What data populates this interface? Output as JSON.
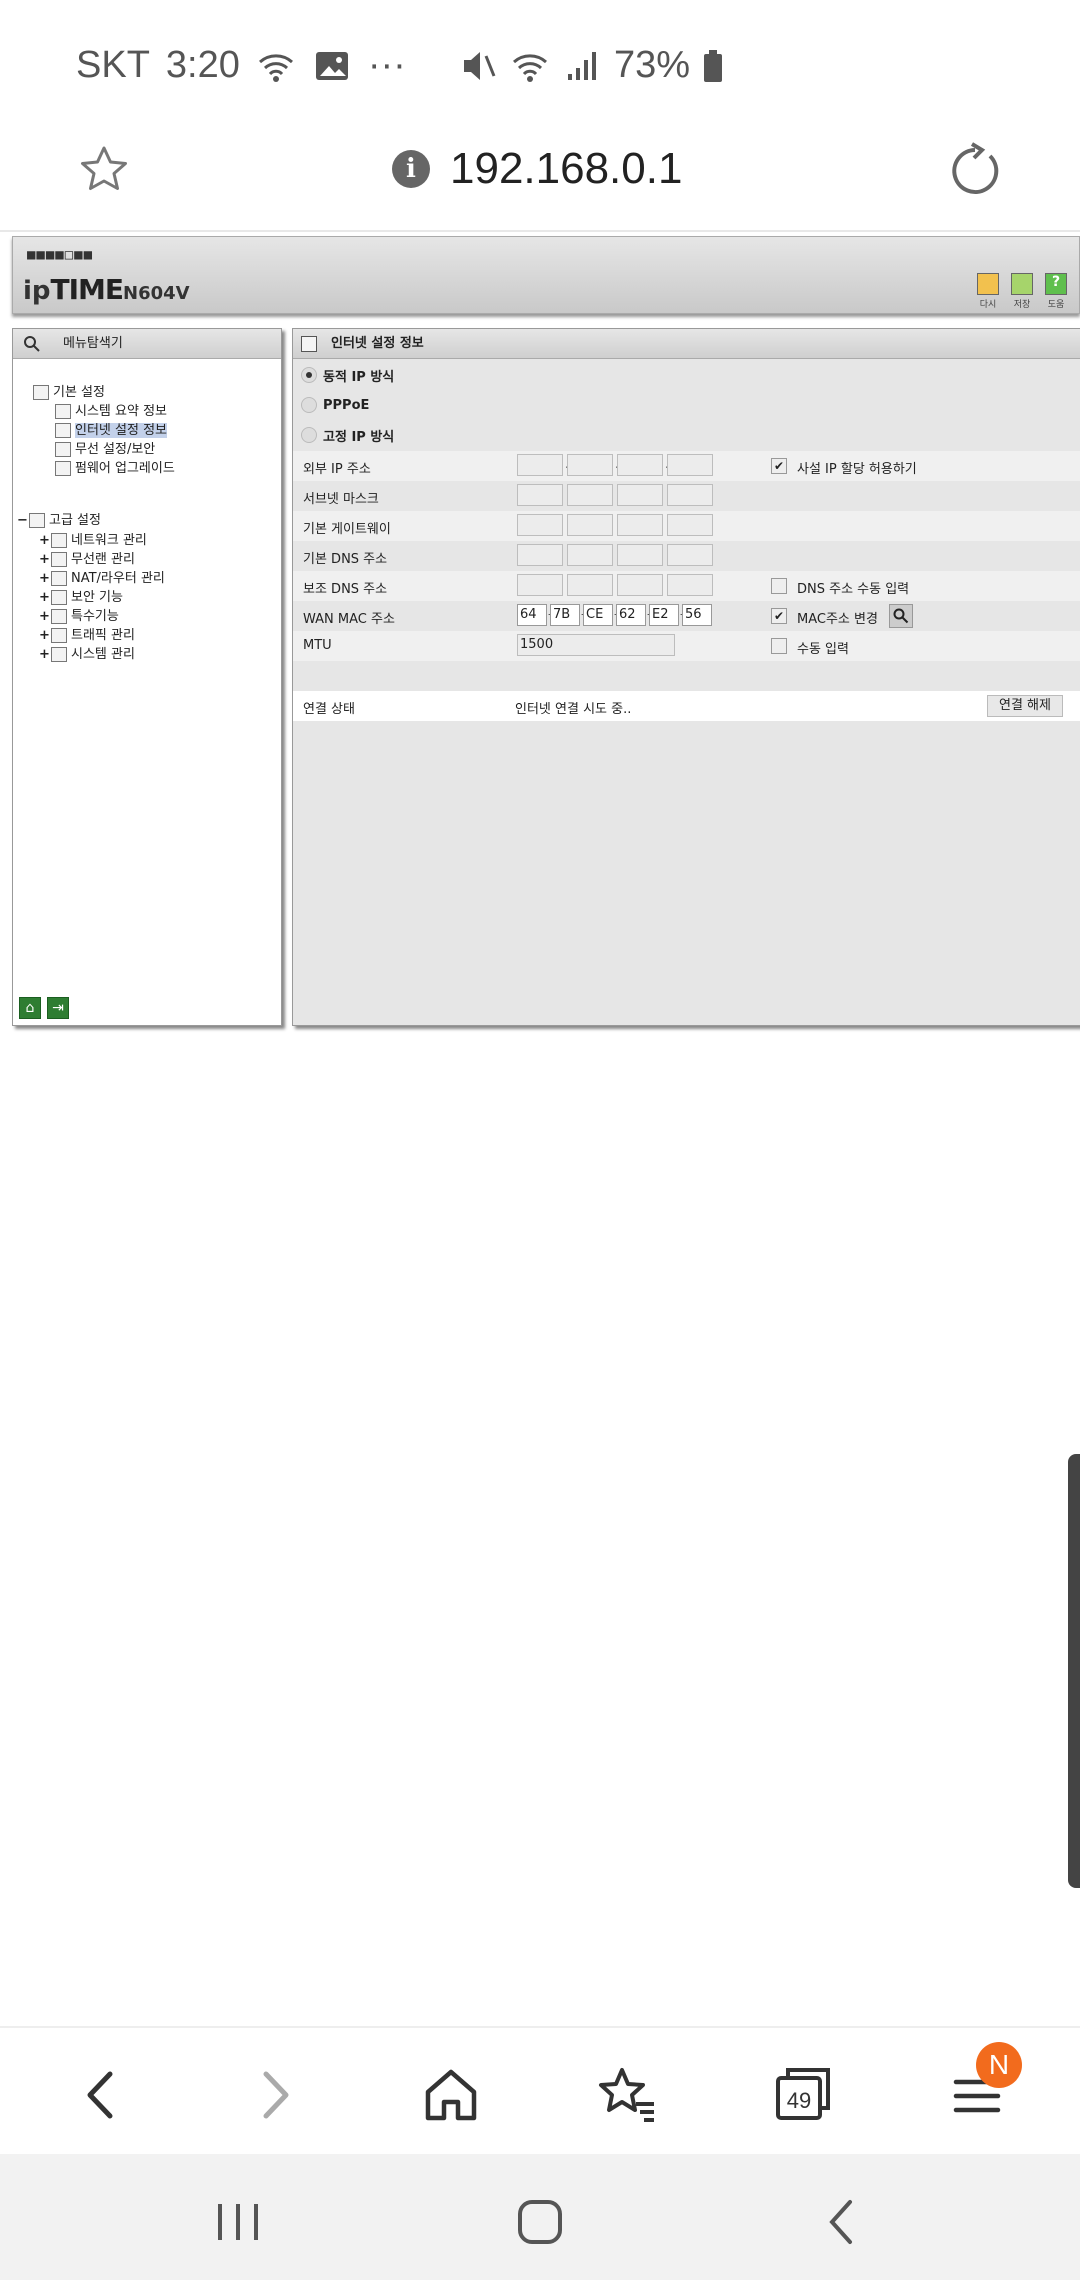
{
  "status_bar": {
    "carrier": "SKT",
    "time": "3:20",
    "more": "···",
    "battery": "73%"
  },
  "browser": {
    "url": "192.168.0.1",
    "tab_count": "49",
    "menu_badge": "N"
  },
  "router": {
    "brand_prefix": "ip",
    "brand_main": "TIME",
    "model": "N604V",
    "toolbar": {
      "reload": "다시",
      "save": "저장",
      "help": "도움"
    },
    "sidebar": {
      "title": "메뉴탐색기",
      "basic": {
        "label": "기본 설정",
        "items": [
          "시스템 요약 정보",
          "인터넷 설정 정보",
          "무선 설정/보안",
          "펌웨어 업그레이드"
        ]
      },
      "advanced": {
        "label": "고급 설정",
        "items": [
          "네트워크 관리",
          "무선랜 관리",
          "NAT/라우터 관리",
          "보안 기능",
          "특수기능",
          "트래픽 관리",
          "시스템 관리"
        ]
      }
    },
    "panel": {
      "title": "인터넷 설정 정보",
      "modes": [
        "동적 IP 방식",
        "PPPoE",
        "고정 IP 방식"
      ],
      "selected_mode": "동적 IP 방식",
      "fields": {
        "external_ip": "외부 IP 주소",
        "subnet": "서브넷 마스크",
        "gateway": "기본 게이트웨이",
        "dns1": "기본 DNS 주소",
        "dns2": "보조 DNS 주소",
        "wan_mac": "WAN MAC 주소",
        "mtu": "MTU"
      },
      "options": {
        "private_ip": {
          "label": "사설 IP 할당 허용하기",
          "checked": true
        },
        "dns_manual": {
          "label": "DNS 주소 수동 입력",
          "checked": false
        },
        "mac_change": {
          "label": "MAC주소 변경",
          "checked": true
        },
        "mtu_manual": {
          "label": "수동 입력",
          "checked": false
        }
      },
      "mac": [
        "64",
        "7B",
        "CE",
        "62",
        "E2",
        "56"
      ],
      "mtu_value": "1500",
      "connection": {
        "label": "연결 상태",
        "status": "인터넷 연결 시도 중..",
        "button": "연결 해제"
      }
    }
  }
}
